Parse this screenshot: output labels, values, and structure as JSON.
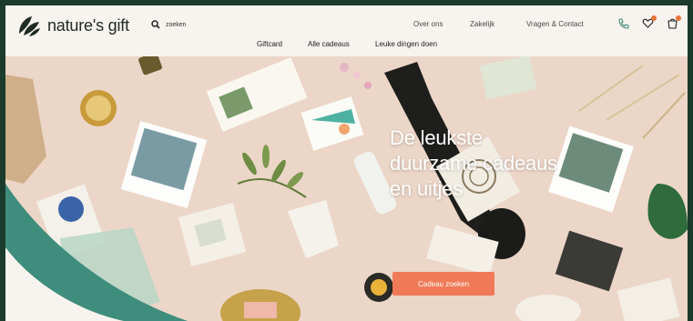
{
  "brand": {
    "name": "nature's gift"
  },
  "search": {
    "placeholder": "zoeken"
  },
  "top_nav": [
    {
      "label": "Over ons"
    },
    {
      "label": "Zakelijk"
    },
    {
      "label": "Vragen & Contact"
    }
  ],
  "header_icons": [
    "phone-icon",
    "heart-icon",
    "cart-icon"
  ],
  "sub_nav": [
    {
      "label": "Giftcard"
    },
    {
      "label": "Alle cadeaus"
    },
    {
      "label": "Leuke dingen doen"
    }
  ],
  "hero": {
    "headline_lines": [
      "De leukste",
      "duurzame cadeaus",
      "en uitjes"
    ],
    "cta_label": "Cadeau zoeken"
  },
  "colors": {
    "frame": "#1b3b2c",
    "header_bg": "#f7f3ee",
    "hero_bg": "#ecd6c8",
    "teal": "#3e8d7d",
    "accent": "#f07a57",
    "badge": "#e8743b"
  }
}
